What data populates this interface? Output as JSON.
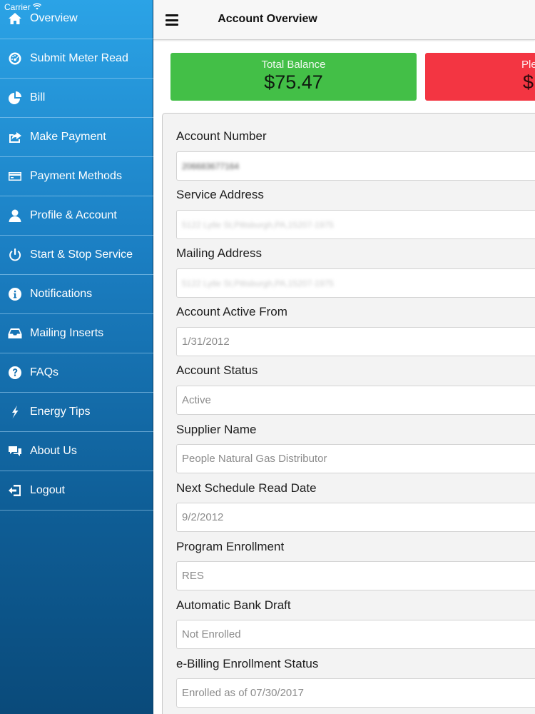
{
  "status_bar": {
    "carrier": "Carrier"
  },
  "sidebar": {
    "items": [
      {
        "label": "Overview",
        "icon": "home-icon"
      },
      {
        "label": "Submit Meter Read",
        "icon": "gauge-icon"
      },
      {
        "label": "Bill",
        "icon": "pie-chart-icon"
      },
      {
        "label": "Make Payment",
        "icon": "share-icon"
      },
      {
        "label": "Payment Methods",
        "icon": "credit-card-icon"
      },
      {
        "label": "Profile & Account",
        "icon": "user-icon"
      },
      {
        "label": "Start & Stop Service",
        "icon": "power-icon"
      },
      {
        "label": "Notifications",
        "icon": "info-icon"
      },
      {
        "label": "Mailing Inserts",
        "icon": "inbox-icon"
      },
      {
        "label": "FAQs",
        "icon": "question-icon"
      },
      {
        "label": "Energy Tips",
        "icon": "bolt-icon"
      },
      {
        "label": "About Us",
        "icon": "chat-icon"
      },
      {
        "label": "Logout",
        "icon": "logout-icon"
      }
    ]
  },
  "navbar": {
    "title": "Account Overview"
  },
  "cards": {
    "total_balance": {
      "label": "Total Balance",
      "value": "$75.47"
    },
    "second": {
      "label": "Ple",
      "value": "$"
    }
  },
  "fields": [
    {
      "label": "Account Number",
      "value": "206683677164"
    },
    {
      "label": "Service Address",
      "value": "5122 Lytle St,Pittsburgh,PA,15207-1975"
    },
    {
      "label": "Mailing Address",
      "value": "5122 Lytle St,Pittsburgh,PA,15207-1975"
    },
    {
      "label": "Account Active From",
      "value": "1/31/2012"
    },
    {
      "label": "Account Status",
      "value": "Active"
    },
    {
      "label": "Supplier Name",
      "value": "People Natural Gas Distributor"
    },
    {
      "label": "Next Schedule Read Date",
      "value": "9/2/2012"
    },
    {
      "label": "Program Enrollment",
      "value": "RES"
    },
    {
      "label": "Automatic Bank Draft",
      "value": "Not Enrolled"
    },
    {
      "label": "e-Billing Enrollment Status",
      "value": "Enrolled as of 07/30/2017"
    }
  ],
  "colors": {
    "accent_green": "#43bf47",
    "accent_red": "#f33542",
    "sidebar_blue": "#1b7fc3"
  }
}
